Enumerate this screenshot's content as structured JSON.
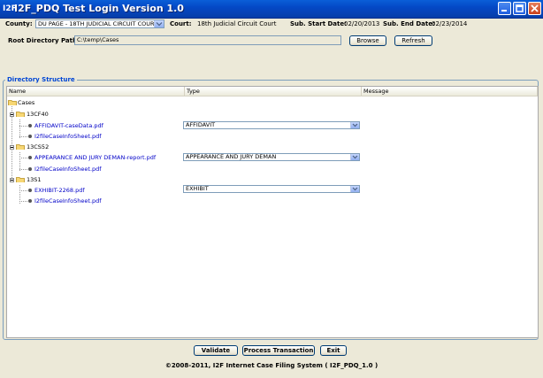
{
  "window": {
    "title": "I2F_PDQ Test Login Version 1.0",
    "icon_text": "I2F"
  },
  "topbar": {
    "county_label": "County:",
    "county_value": "DU PAGE - 18TH JUDICIAL CIRCUIT COURT",
    "court_label": "Court:",
    "court_value": "18th Judicial Circuit Court",
    "start_label": "Sub. Start Date:",
    "start_value": "02/20/2013",
    "end_label": "Sub. End Date:",
    "end_value": "02/23/2014"
  },
  "root": {
    "label": "Root Directory Path",
    "value": "C:\\temp\\Cases",
    "browse_label": "Browse",
    "refresh_label": "Refresh"
  },
  "directory": {
    "group_title": "Directory Structure",
    "columns": [
      "Name",
      "Type",
      "Message"
    ],
    "root_folder": "Cases",
    "folders": [
      {
        "name": "13CF40",
        "files": [
          {
            "name": "AFFIDAVIT-caseData.pdf",
            "type": "AFFIDAVIT"
          },
          {
            "name": "I2fileCaseInfoSheet.pdf",
            "type": null
          }
        ]
      },
      {
        "name": "13CS52",
        "files": [
          {
            "name": "APPEARANCE AND JURY DEMAN-report.pdf",
            "type": "APPEARANCE AND JURY DEMAN"
          },
          {
            "name": "I2fileCaseInfoSheet.pdf",
            "type": null
          }
        ]
      },
      {
        "name": "13S1",
        "files": [
          {
            "name": "EXHIBIT-2268.pdf",
            "type": "EXHIBIT"
          },
          {
            "name": "I2fileCaseInfoSheet.pdf",
            "type": null
          }
        ]
      }
    ]
  },
  "actions": {
    "validate_label": "Validate",
    "process_label": "Process Transaction",
    "exit_label": "Exit"
  },
  "footer": {
    "copyright": "©2008-2011, I2F Internet Case Filing System ( I2F_PDQ_1.0 )"
  },
  "colors": {
    "titlebar": "#0449c6",
    "window_bg": "#ece9d8",
    "file_link": "#0000c8",
    "group_title": "#0046d5"
  }
}
